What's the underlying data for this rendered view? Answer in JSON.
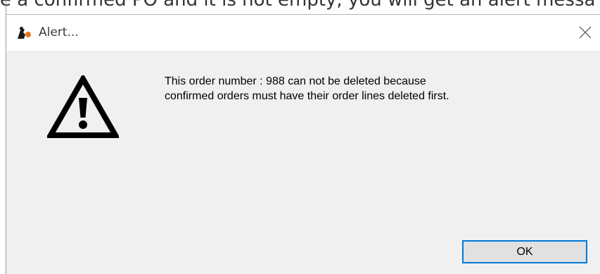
{
  "background": {
    "partial_text": "e a confirmed PO and it is not empty, you will get an alert messa"
  },
  "dialog": {
    "title": "Alert...",
    "icons": {
      "app": "app-logo-icon",
      "close": "close-icon",
      "warning": "warning-exclamation-icon"
    },
    "message": {
      "line1": "This order number : 988 can not be deleted  because",
      "line2": "confirmed orders must have their order lines deleted first."
    },
    "ok_label": "OK"
  },
  "colors": {
    "dialog_bg": "#f0f0f0",
    "titlebar_bg": "#ffffff",
    "focus_border": "#0078d7",
    "button_bg": "#e1e1e1"
  }
}
